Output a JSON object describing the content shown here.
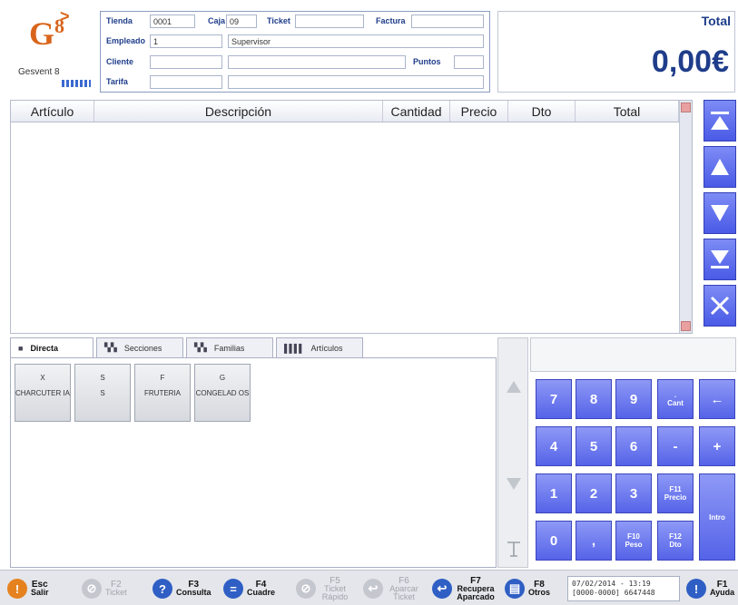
{
  "logo": {
    "brand": "G",
    "brand_sup": "8",
    "product": "Gesvent 8"
  },
  "info": {
    "tienda_label": "Tienda",
    "tienda_value": "0001",
    "caja_label": "Caja",
    "caja_value": "09",
    "ticket_label": "Ticket",
    "ticket_value": "",
    "factura_label": "Factura",
    "factura_value": "",
    "empleado_label": "Empleado",
    "empleado_id": "1",
    "empleado_name": "Supervisor",
    "cliente_label": "Cliente",
    "cliente_id": "",
    "cliente_name": "",
    "puntos_label": "Puntos",
    "puntos_value": "",
    "tarifa_label": "Tarifa",
    "tarifa_id": "",
    "tarifa_name": ""
  },
  "total": {
    "label": "Total",
    "value": "0,00€"
  },
  "grid": {
    "columns": [
      "Artículo",
      "Descripción",
      "Cantidad",
      "Precio",
      "Dto",
      "Total"
    ],
    "rows": []
  },
  "nav": [
    {
      "name": "scroll-first-button",
      "icon": "first-icon"
    },
    {
      "name": "scroll-up-button",
      "icon": "up-icon"
    },
    {
      "name": "scroll-down-button",
      "icon": "down-icon"
    },
    {
      "name": "scroll-last-button",
      "icon": "last-icon"
    },
    {
      "name": "delete-line-button",
      "icon": "close-icon"
    }
  ],
  "tabs": [
    {
      "label": "Directa",
      "icon": "folder-icon",
      "active": true
    },
    {
      "label": "Secciones",
      "icon": "sections-icon",
      "active": false
    },
    {
      "label": "Familias",
      "icon": "families-icon",
      "active": false
    },
    {
      "label": "Artículos",
      "icon": "barcode-icon",
      "active": false
    }
  ],
  "categories": [
    {
      "code": "X",
      "name": "CHARCUTER IA"
    },
    {
      "code": "S",
      "name": "S"
    },
    {
      "code": "F",
      "name": "FRUTERIA"
    },
    {
      "code": "G",
      "name": "CONGELAD OS"
    }
  ],
  "keypad": {
    "k7": "7",
    "k8": "8",
    "k9": "9",
    "cant_top": ".",
    "cant": "Cant",
    "back": "←",
    "k4": "4",
    "k5": "5",
    "k6": "6",
    "minus": "-",
    "plus": "+",
    "k1": "1",
    "k2": "2",
    "k3": "3",
    "f11": "F11",
    "f11_sub": "Precio",
    "intro": "Intro",
    "k0": "0",
    "comma": ",",
    "f10": "F10",
    "f10_sub": "Peso",
    "f12": "F12",
    "f12_sub": "Dto"
  },
  "fkeys": {
    "esc_k": "Esc",
    "esc_t": "Salir",
    "f2_k": "F2",
    "f2_t": "Ticket",
    "f3_k": "F3",
    "f3_t": "Consulta",
    "f4_k": "F4",
    "f4_t": "Cuadre",
    "f5_k": "F5",
    "f5_t": "Ticket Rápido",
    "f6_k": "F6",
    "f6_t": "Aparcar Ticket",
    "f7_k": "F7",
    "f7_t": "Recupera Aparcado",
    "f8_k": "F8",
    "f8_t": "Otros",
    "f1_k": "F1",
    "f1_t": "Ayuda"
  },
  "status": {
    "datetime": "07/02/2014 - 13:19",
    "code": "[0000-0000]  6647448"
  },
  "colors": {
    "brand": "#d9651b",
    "accent": "#1f3d8a",
    "key": "#5563e8"
  }
}
